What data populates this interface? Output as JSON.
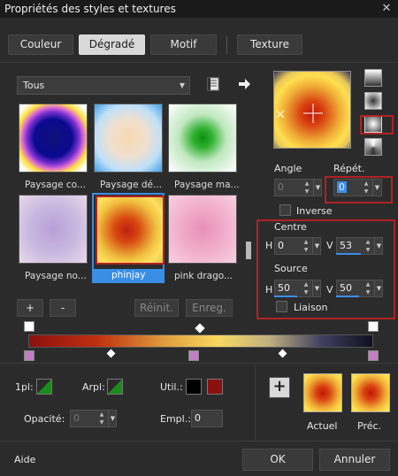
{
  "window": {
    "title": "Propriétés des styles et textures",
    "close_glyph": "✕"
  },
  "tabs": [
    {
      "label": "Couleur"
    },
    {
      "label": "Dégradé"
    },
    {
      "label": "Motif"
    },
    {
      "label": "Texture"
    }
  ],
  "library": {
    "category": "Tous",
    "thumbnails": [
      {
        "label": "Paysage co..."
      },
      {
        "label": "Paysage dé..."
      },
      {
        "label": "Paysage ma..."
      },
      {
        "label": "Paysage no..."
      },
      {
        "label": "phinjay"
      },
      {
        "label": "pink drago..."
      }
    ],
    "add_label": "+",
    "remove_label": "-",
    "reset_label": "Réinit.",
    "save_label": "Enreg."
  },
  "gradient": {
    "angle_label": "Angle",
    "angle_value": "0",
    "repeat_label": "Répét.",
    "repeat_value": "0",
    "invert_label": "Inverse",
    "center_label": "Centre",
    "center_h_label": "H",
    "center_h": "0",
    "center_v_label": "V",
    "center_v": "53",
    "source_label": "Source",
    "source_h_label": "H",
    "source_h": "50",
    "source_v_label": "V",
    "source_v": "50",
    "link_label": "Liaison"
  },
  "stops": {
    "opacity_label": "1pl:",
    "arrange_label": "Arpl:",
    "use_label": "Util.:",
    "opacity_field_label": "Opacité:",
    "opacity_value": "0",
    "location_label": "Empl.:",
    "location_value": "0"
  },
  "preview": {
    "plus_label": "+",
    "current_label": "Actuel",
    "previous_label": "Préc."
  },
  "footer": {
    "help_label": "Aide",
    "ok_label": "OK",
    "cancel_label": "Annuler"
  },
  "colors": {
    "accent": "#3a8ee6",
    "highlight": "#b22222",
    "user_color_1": "#000000",
    "user_color_2": "#8b1010"
  }
}
